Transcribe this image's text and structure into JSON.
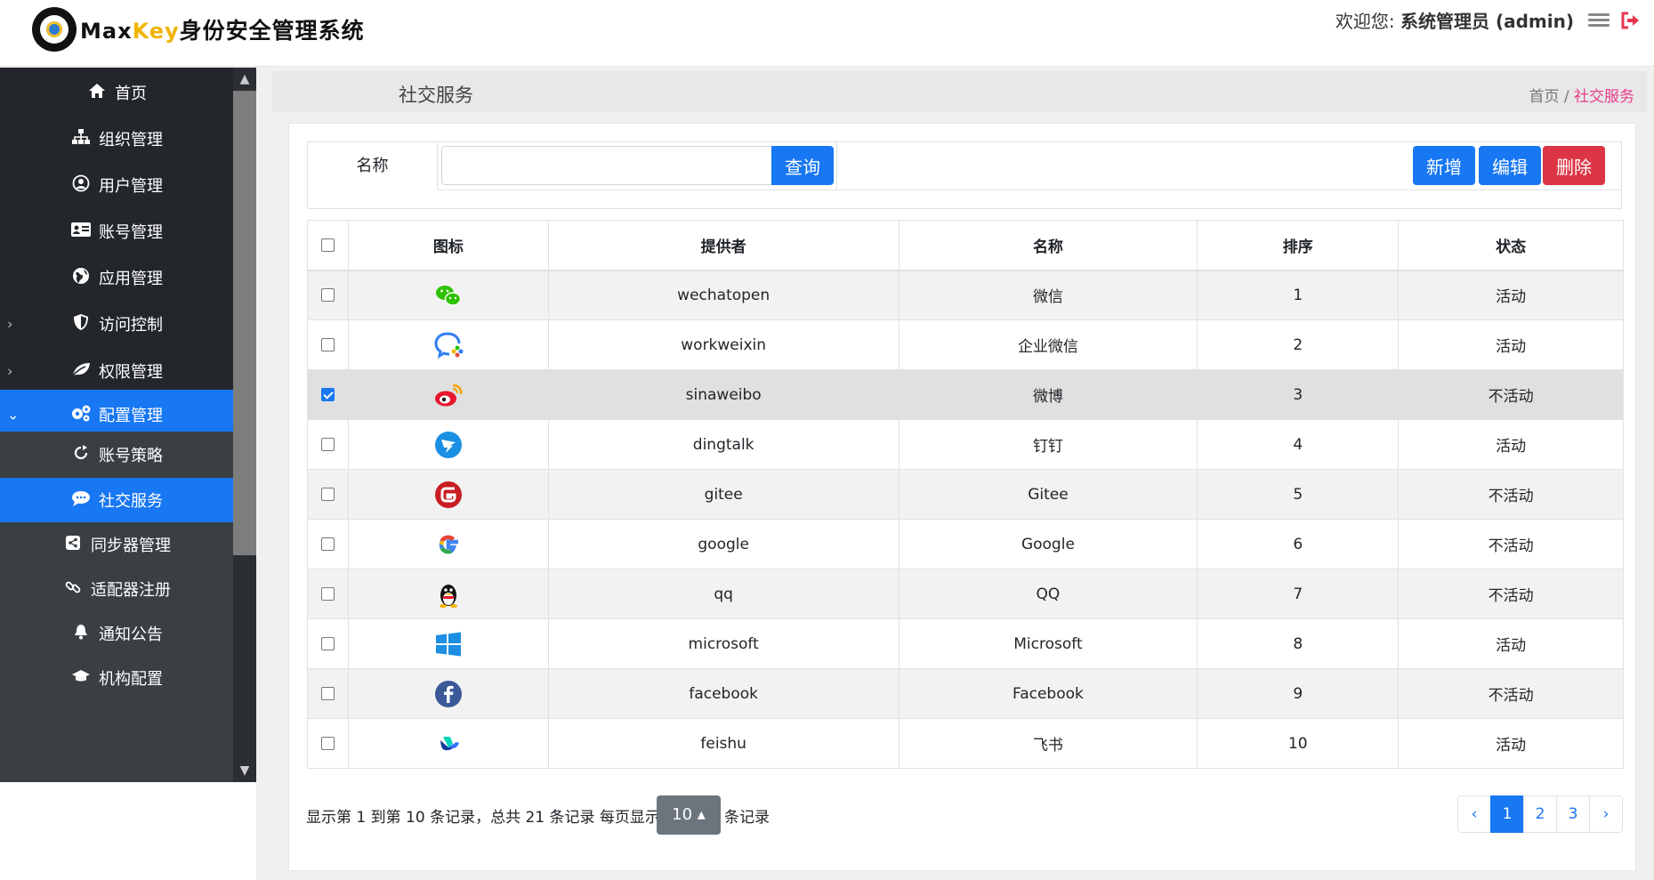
{
  "header": {
    "logo_max": "Max",
    "logo_key": "Key",
    "logo_rest": "身份安全管理系统",
    "welcome_prefix": "欢迎您: ",
    "welcome_user": "系统管理员 (admin)"
  },
  "sidebar": {
    "items": [
      {
        "label": "首页",
        "icon": "home-icon"
      },
      {
        "label": "组织管理",
        "icon": "org-tree-icon"
      },
      {
        "label": "用户管理",
        "icon": "user-circle-icon"
      },
      {
        "label": "账号管理",
        "icon": "id-card-icon"
      },
      {
        "label": "应用管理",
        "icon": "globe-icon"
      },
      {
        "label": "访问控制",
        "icon": "shield-icon"
      },
      {
        "label": "权限管理",
        "icon": "leaf-icon"
      },
      {
        "label": "配置管理",
        "icon": "gears-icon"
      },
      {
        "label": "账号策略",
        "icon": "refresh-icon"
      },
      {
        "label": "社交服务",
        "icon": "chat-icon"
      },
      {
        "label": "同步器管理",
        "icon": "share-icon"
      },
      {
        "label": "适配器注册",
        "icon": "link-icon"
      },
      {
        "label": "通知公告",
        "icon": "bell-icon"
      },
      {
        "label": "机构配置",
        "icon": "graduation-icon"
      }
    ]
  },
  "page": {
    "title": "社交服务",
    "breadcrumb_home": "首页",
    "breadcrumb_sep": " / ",
    "breadcrumb_current": "社交服务"
  },
  "search": {
    "label": "名称",
    "value": "",
    "query_label": "查询"
  },
  "toolbar": {
    "add_label": "新增",
    "edit_label": "编辑",
    "delete_label": "删除"
  },
  "table": {
    "headers": [
      "图标",
      "提供者",
      "名称",
      "排序",
      "状态"
    ],
    "rows": [
      {
        "icon": "wechat-icon",
        "provider": "wechatopen",
        "name": "微信",
        "order": "1",
        "status": "活动",
        "checked": false
      },
      {
        "icon": "workweixin-icon",
        "provider": "workweixin",
        "name": "企业微信",
        "order": "2",
        "status": "活动",
        "checked": false
      },
      {
        "icon": "weibo-icon",
        "provider": "sinaweibo",
        "name": "微博",
        "order": "3",
        "status": "不活动",
        "checked": true
      },
      {
        "icon": "dingtalk-icon",
        "provider": "dingtalk",
        "name": "钉钉",
        "order": "4",
        "status": "活动",
        "checked": false
      },
      {
        "icon": "gitee-icon",
        "provider": "gitee",
        "name": "Gitee",
        "order": "5",
        "status": "不活动",
        "checked": false
      },
      {
        "icon": "google-icon",
        "provider": "google",
        "name": "Google",
        "order": "6",
        "status": "不活动",
        "checked": false
      },
      {
        "icon": "qq-icon",
        "provider": "qq",
        "name": "QQ",
        "order": "7",
        "status": "不活动",
        "checked": false
      },
      {
        "icon": "microsoft-icon",
        "provider": "microsoft",
        "name": "Microsoft",
        "order": "8",
        "status": "活动",
        "checked": false
      },
      {
        "icon": "facebook-icon",
        "provider": "facebook",
        "name": "Facebook",
        "order": "9",
        "status": "不活动",
        "checked": false
      },
      {
        "icon": "feishu-icon",
        "provider": "feishu",
        "name": "飞书",
        "order": "10",
        "status": "活动",
        "checked": false
      }
    ]
  },
  "footer": {
    "info": "显示第 1 到第 10 条记录，总共 21 条记录  每页显示",
    "page_size": "10 ▴",
    "tail": "条记录",
    "pages": [
      "‹",
      "1",
      "2",
      "3",
      "›"
    ]
  },
  "colors": {
    "primary": "#1877f2",
    "danger": "#dc3545",
    "sidebar_bg": "#23272b"
  }
}
